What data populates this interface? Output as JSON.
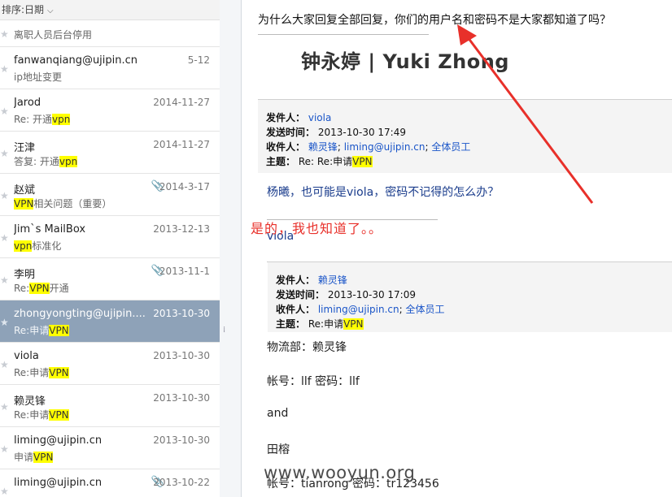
{
  "message_list": {
    "sort_label": "排序:日期",
    "items": [
      {
        "sender": "",
        "date": "",
        "subject": [
          {
            "t": "离职人员后台停用",
            "hl": false
          }
        ],
        "attachment": false,
        "selected": false,
        "first": true
      },
      {
        "sender": "fanwanqiang@ujipin.cn",
        "date": "5-12",
        "subject": [
          {
            "t": "ip地址变更",
            "hl": false
          }
        ],
        "attachment": false,
        "selected": false
      },
      {
        "sender": "Jarod",
        "date": "2014-11-27",
        "subject": [
          {
            "t": "Re: 开通",
            "hl": false
          },
          {
            "t": "vpn",
            "hl": true
          }
        ],
        "attachment": false,
        "selected": false
      },
      {
        "sender": "汪津",
        "date": "2014-11-27",
        "subject": [
          {
            "t": "答复: 开通",
            "hl": false
          },
          {
            "t": "vpn",
            "hl": true
          }
        ],
        "attachment": false,
        "selected": false
      },
      {
        "sender": "赵斌",
        "date": "2014-3-17",
        "subject": [
          {
            "t": "VPN",
            "hl": true
          },
          {
            "t": "相关问题（重要）",
            "hl": false
          }
        ],
        "attachment": true,
        "selected": false
      },
      {
        "sender": "Jim`s MailBox",
        "date": "2013-12-13",
        "subject": [
          {
            "t": "vpn",
            "hl": true
          },
          {
            "t": "标准化",
            "hl": false
          }
        ],
        "attachment": false,
        "selected": false
      },
      {
        "sender": "李明",
        "date": "2013-11-1",
        "subject": [
          {
            "t": "Re:",
            "hl": false
          },
          {
            "t": "VPN",
            "hl": true
          },
          {
            "t": "开通",
            "hl": false
          }
        ],
        "attachment": true,
        "selected": false
      },
      {
        "sender": "zhongyongting@ujipin....",
        "date": "2013-10-30",
        "subject": [
          {
            "t": "Re:申请",
            "hl": false
          },
          {
            "t": "VPN",
            "hl": true
          }
        ],
        "attachment": false,
        "selected": true
      },
      {
        "sender": "viola",
        "date": "2013-10-30",
        "subject": [
          {
            "t": "Re:申请",
            "hl": false
          },
          {
            "t": "VPN",
            "hl": true
          }
        ],
        "attachment": false,
        "selected": false
      },
      {
        "sender": "赖灵锋",
        "date": "2013-10-30",
        "subject": [
          {
            "t": "Re:申请",
            "hl": false
          },
          {
            "t": "VPN",
            "hl": true
          }
        ],
        "attachment": false,
        "selected": false
      },
      {
        "sender": "liming@ujipin.cn",
        "date": "2013-10-30",
        "subject": [
          {
            "t": "申请",
            "hl": false
          },
          {
            "t": "VPN",
            "hl": true
          }
        ],
        "attachment": false,
        "selected": false
      },
      {
        "sender": "liming@ujipin.cn",
        "date": "2013-10-22",
        "subject": [],
        "attachment": true,
        "selected": false
      }
    ]
  },
  "reader": {
    "top_question": "为什么大家回复全部回复，你们的用户名和密码不是大家都知道了吗？",
    "signature_name": "钟永婷 | Yuki Zhong",
    "header1": {
      "from_label": "发件人：",
      "from": "viola",
      "sent_label": "发送时间：",
      "sent": "2013-10-30 17:49",
      "to_label": "收件人：",
      "to": [
        "赖灵锋",
        "liming@ujipin.cn",
        "全体员工"
      ],
      "subject_label": "主题：",
      "subject_prefix": "Re: Re:申请",
      "subject_hl": "VPN"
    },
    "body1": "杨曦，也可能是viola，密码不记得的怎么办？",
    "viola_signature": "viola",
    "header2": {
      "from_label": "发件人：",
      "from": "赖灵锋",
      "sent_label": "发送时间：",
      "sent": "2013-10-30 17:09",
      "to_label": "收件人：",
      "to": [
        "liming@ujipin.cn",
        "全体员工"
      ],
      "subject_label": "主题：",
      "subject_prefix": "Re:申请",
      "subject_hl": "VPN"
    },
    "body2": [
      "物流部：赖灵锋",
      " 帐号：llf  密码：llf",
      " and",
      "田榕",
      "帐号：tianrong  密码：tr123456"
    ]
  },
  "annotation": "是的，我也知道了。。",
  "watermark": "www.wooyun.org",
  "colors": {
    "selected_row": "#8ea2b8",
    "highlight": "#ffff00",
    "link": "#1a55c8",
    "annotation": "#e8302a"
  },
  "icons": [
    "star-icon",
    "paperclip-icon",
    "chevron-down-icon",
    "splitter-grip-icon"
  ]
}
